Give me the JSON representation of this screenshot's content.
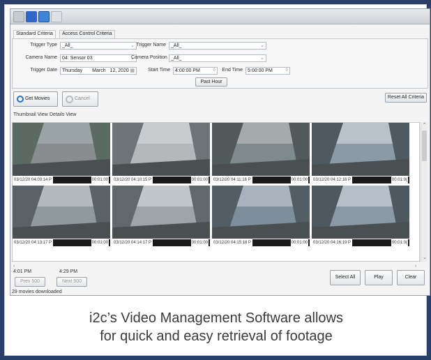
{
  "tabs": {
    "standard": "Standard Criteria",
    "access": "Access Control Criteria"
  },
  "criteria": {
    "trigger_type_label": "Trigger Type",
    "trigger_type_value": "_All_",
    "trigger_name_label": "Trigger Name",
    "trigger_name_value": "_All_",
    "camera_name_label": "Camera Name",
    "camera_name_value": "04: Sensor 03",
    "camera_position_label": "Camera Position",
    "camera_position_value": "_All_",
    "trigger_date_label": "Trigger Date",
    "trigger_date_weekday": "Thursday",
    "trigger_date_month": "March",
    "trigger_date_day": "12, 2020",
    "start_time_label": "Start Time",
    "start_time_value": "4:00:00 PM",
    "end_time_label": "End Time",
    "end_time_value": "5:00:00 PM",
    "past_hour_label": "Past Hour"
  },
  "actions": {
    "get_movies": "Get Movies",
    "cancel": "Cancel",
    "reset_all": "Reset All Criteria"
  },
  "views": {
    "thumbnail": "Thumbnail View",
    "detail": "Details View"
  },
  "thumbnails": [
    {
      "timestamp": "03/12/20 04:09:14 P",
      "duration": "00:01:00"
    },
    {
      "timestamp": "03/12/20 04:10:15 P",
      "duration": "00:01:00"
    },
    {
      "timestamp": "03/12/20 04:11:16 P",
      "duration": "00:01:00"
    },
    {
      "timestamp": "03/12/20 04:12:16 P",
      "duration": "00:01:0("
    },
    {
      "timestamp": "03/12/20 04:13:17 P",
      "duration": "00:01:00"
    },
    {
      "timestamp": "03/12/20 04:14:17 P",
      "duration": "00:01:00"
    },
    {
      "timestamp": "03/12/20 04:15:18 P",
      "duration": "00:01:00"
    },
    {
      "timestamp": "03/12/20 04:16:19 P",
      "duration": "00:01:0("
    }
  ],
  "range": {
    "start": "4:01 PM",
    "end": "4:29 PM"
  },
  "paging": {
    "prev": "Prev 500",
    "next": "Next 500"
  },
  "bottom_buttons": {
    "select_all": "Select All",
    "play": "Play",
    "clear": "Clear"
  },
  "status": "29 movies downloaded",
  "caption": {
    "line1": "i2c’s Video Management Software allows",
    "line2": "for quick and easy retrieval of footage"
  },
  "colors": {
    "frame": "#2b3f6b",
    "window_bg": "#f4f4f4",
    "caption_text": "#3a3a3a"
  }
}
